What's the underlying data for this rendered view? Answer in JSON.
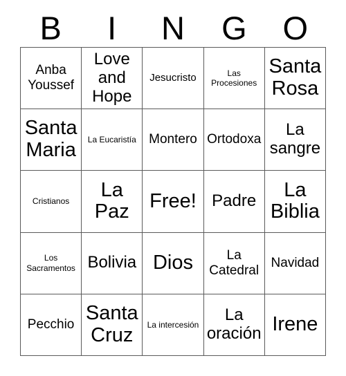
{
  "card": {
    "title": "BINGO Card",
    "header_letters": [
      "B",
      "I",
      "N",
      "G",
      "O"
    ],
    "border_color": "#5a5a5a",
    "text_color": "#000000",
    "background_color": "#ffffff",
    "free_space": "Free!",
    "rows": [
      [
        {
          "label": "Anba Youssef",
          "size": "m"
        },
        {
          "label": "Love and Hope",
          "size": "l"
        },
        {
          "label": "Jesucristo",
          "size": "s"
        },
        {
          "label": "Las Procesiones",
          "size": "xs"
        },
        {
          "label": "Santa Rosa",
          "size": "xl"
        }
      ],
      [
        {
          "label": "Santa Maria",
          "size": "xl"
        },
        {
          "label": "La Eucaristía",
          "size": "xs"
        },
        {
          "label": "Montero",
          "size": "m"
        },
        {
          "label": "Ortodoxa",
          "size": "m"
        },
        {
          "label": "La sangre",
          "size": "l"
        }
      ],
      [
        {
          "label": "Cristianos",
          "size": "xs"
        },
        {
          "label": "La Paz",
          "size": "xl"
        },
        {
          "label": "Free!",
          "size": "xl"
        },
        {
          "label": "Padre",
          "size": "l"
        },
        {
          "label": "La Biblia",
          "size": "xl"
        }
      ],
      [
        {
          "label": "Los Sacramentos",
          "size": "xs"
        },
        {
          "label": "Bolivia",
          "size": "l"
        },
        {
          "label": "Dios",
          "size": "xl"
        },
        {
          "label": "La Catedral",
          "size": "m"
        },
        {
          "label": "Navidad",
          "size": "m"
        }
      ],
      [
        {
          "label": "Pecchio",
          "size": "m"
        },
        {
          "label": "Santa Cruz",
          "size": "xl"
        },
        {
          "label": "La intercesión",
          "size": "xs"
        },
        {
          "label": "La oración",
          "size": "l"
        },
        {
          "label": "Irene",
          "size": "xl"
        }
      ]
    ]
  }
}
